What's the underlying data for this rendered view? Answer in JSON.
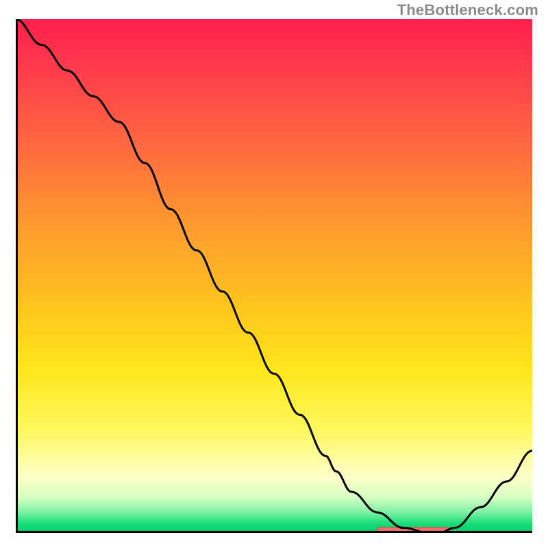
{
  "attribution": "TheBottleneck.com",
  "colors": {
    "gradient_top": "#ff1f4c",
    "gradient_bottom": "#00c86a",
    "curve": "#000000",
    "marker": "#f46a6a"
  },
  "chart_data": {
    "type": "line",
    "title": "",
    "xlabel": "",
    "ylabel": "",
    "xlim": [
      0,
      100
    ],
    "ylim": [
      0,
      100
    ],
    "series": [
      {
        "name": "bottleneck-curve",
        "x": [
          0,
          5,
          10,
          15,
          20,
          25,
          30,
          35,
          40,
          45,
          50,
          55,
          60,
          62,
          65,
          70,
          75,
          80,
          82,
          85,
          90,
          95,
          100
        ],
        "values": [
          100,
          95,
          90,
          85,
          80,
          72,
          63,
          55,
          47,
          39,
          31,
          23,
          15,
          12,
          8,
          4,
          1,
          0,
          0,
          1,
          5,
          10,
          16
        ]
      }
    ],
    "annotations": [
      {
        "name": "optimal-range",
        "x_start": 70,
        "x_end": 84,
        "y": 0
      }
    ]
  }
}
